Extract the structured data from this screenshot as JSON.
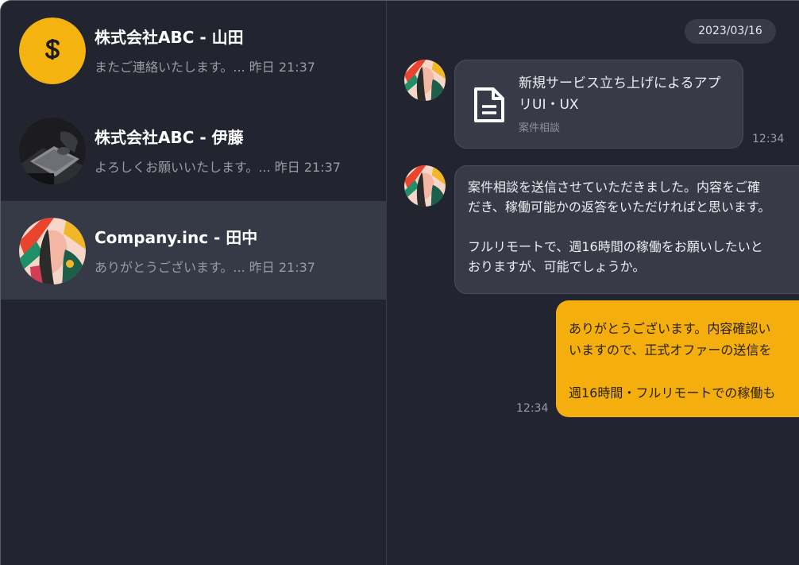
{
  "conversations": [
    {
      "name": "株式会社ABC - 山田",
      "preview": "またご連絡いたします。... 昨日 21:37",
      "avatar": "s-logo-icon"
    },
    {
      "name": "株式会社ABC - 伊藤",
      "preview": "よろしくお願いいたします。... 昨日 21:37",
      "avatar": "laptop-photo"
    },
    {
      "name": "Company.inc - 田中",
      "preview": "ありがとうございます。... 昨日 21:37",
      "avatar": "colorful-illustration"
    }
  ],
  "chat": {
    "date": "2023/03/16",
    "messages": [
      {
        "type": "file",
        "title": "新規サービス立ち上げによるアプリUI・UX",
        "subtitle": "案件相談",
        "time": "12:34"
      },
      {
        "type": "text",
        "text": "案件相談を送信させていただきました。内容をご確\nだき、稼働可能かの返答をいただければと思います。\n\nフルリモートで、週16時間の稼働をお願いしたいと\nおりますが、可能でしょうか。"
      },
      {
        "type": "mine",
        "text": "ありがとうございます。内容確認い\nいますので、正式オファーの送信を\n\n週16時間・フルリモートでの稼働も",
        "time": "12:34"
      }
    ]
  },
  "colors": {
    "background": "#22252f",
    "active_row": "#363946",
    "bubble": "#383b47",
    "accent": "#f4ae0e"
  }
}
